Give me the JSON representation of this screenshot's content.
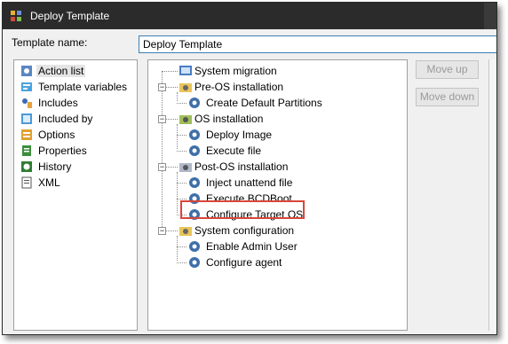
{
  "window": {
    "title": "Deploy Template"
  },
  "form": {
    "template_name_label": "Template name:",
    "template_name_value": "Deploy Template"
  },
  "left_list": {
    "items": [
      {
        "label": "Action list",
        "icon": "action-list-icon",
        "selected": true
      },
      {
        "label": "Template variables",
        "icon": "template-variables-icon"
      },
      {
        "label": "Includes",
        "icon": "includes-icon"
      },
      {
        "label": "Included by",
        "icon": "included-by-icon"
      },
      {
        "label": "Options",
        "icon": "options-icon"
      },
      {
        "label": "Properties",
        "icon": "properties-icon"
      },
      {
        "label": "History",
        "icon": "history-icon"
      },
      {
        "label": "XML",
        "icon": "xml-icon"
      }
    ]
  },
  "tree": {
    "system_migration": "System migration",
    "pre_os": "Pre-OS installation",
    "create_default_partitions": "Create Default Partitions",
    "os_install": "OS installation",
    "deploy_image": "Deploy Image",
    "execute_file": "Execute file",
    "post_os": "Post-OS installation",
    "inject_unattend": "Inject unattend file",
    "execute_bcdboot": "Execute BCDBoot",
    "configure_target_os": "Configure Target OS",
    "system_config": "System configuration",
    "enable_admin_user": "Enable Admin User",
    "configure_agent": "Configure agent"
  },
  "buttons": {
    "move_up": "Move up",
    "move_down": "Move down"
  },
  "colors": {
    "highlight": "#d9463a",
    "titlebar": "#2b2b2b"
  }
}
